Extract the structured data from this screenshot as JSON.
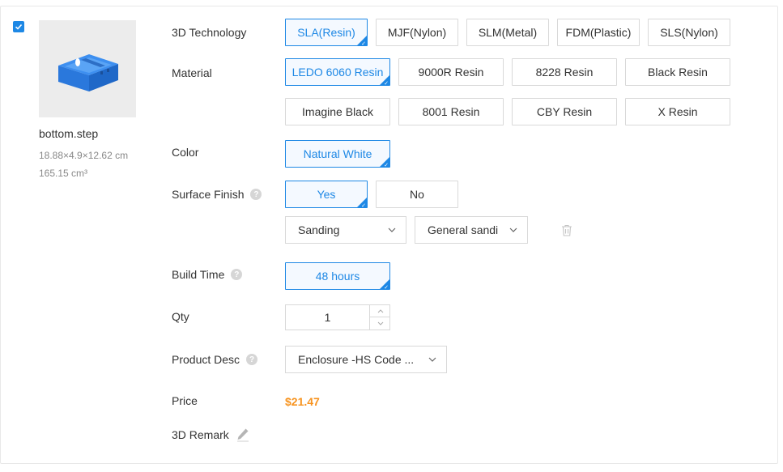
{
  "product": {
    "checked": true,
    "filename": "bottom.step",
    "dimensions": "18.88×4.9×12.62 cm",
    "volume": "165.15 cm³"
  },
  "labels": {
    "technology": "3D Technology",
    "material": "Material",
    "color": "Color",
    "surface_finish": "Surface Finish",
    "build_time": "Build Time",
    "qty": "Qty",
    "product_desc": "Product Desc",
    "price": "Price",
    "remark": "3D Remark"
  },
  "technology": {
    "options": [
      "SLA(Resin)",
      "MJF(Nylon)",
      "SLM(Metal)",
      "FDM(Plastic)",
      "SLS(Nylon)"
    ],
    "selected": "SLA(Resin)"
  },
  "material": {
    "options": [
      "LEDO 6060 Resin",
      "9000R Resin",
      "8228 Resin",
      "Black Resin",
      "Imagine Black",
      "8001 Resin",
      "CBY Resin",
      "X Resin"
    ],
    "selected": "LEDO 6060 Resin"
  },
  "color": {
    "options": [
      "Natural White"
    ],
    "selected": "Natural White"
  },
  "surface_finish": {
    "options": [
      "Yes",
      "No"
    ],
    "selected": "Yes",
    "method": "Sanding",
    "detail": "General sandi"
  },
  "build_time": {
    "options": [
      "48 hours"
    ],
    "selected": "48 hours"
  },
  "qty": {
    "value": "1"
  },
  "product_desc": {
    "value": "Enclosure -HS Code ..."
  },
  "price": {
    "value": "$21.47",
    "color": "#f7931e"
  },
  "help_icon_text": "?",
  "accent_color": "#1e88e5"
}
